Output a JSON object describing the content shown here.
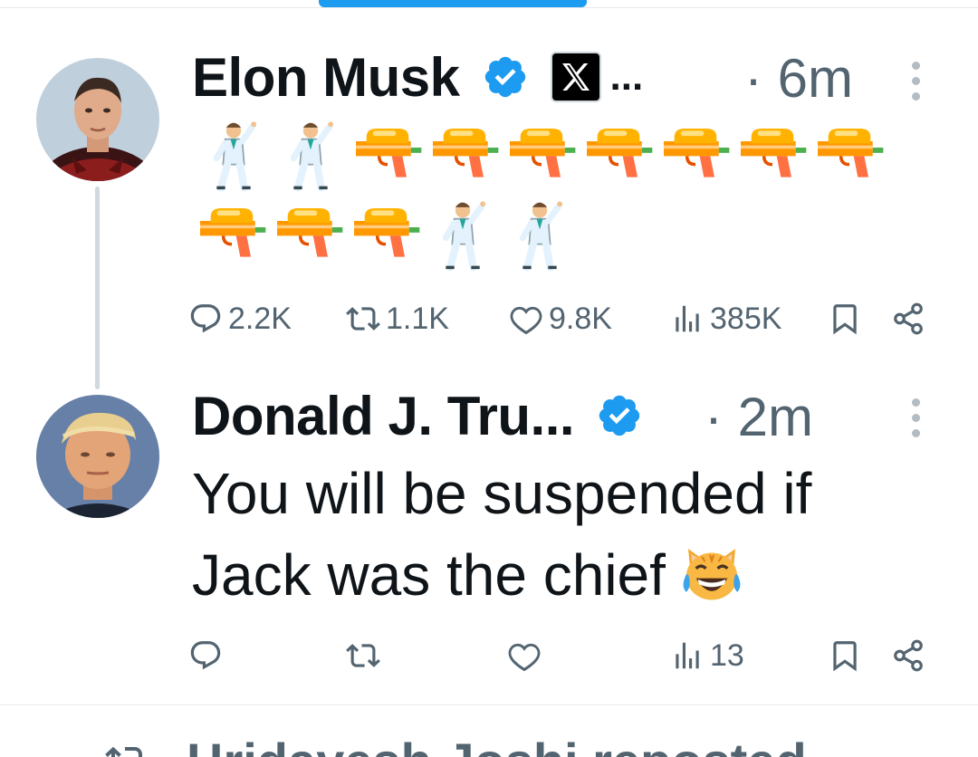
{
  "tweets": [
    {
      "author": {
        "display_name": "Elon Musk",
        "verified_color": "#1d9bf0",
        "affiliation_badge": "x-logo-icon",
        "truncation": "..."
      },
      "time": "· 6m",
      "content": {
        "emoji_line_1": [
          "man-dancing-icon",
          "man-dancing-icon",
          "water-pistol-icon",
          "water-pistol-icon",
          "water-pistol-icon",
          "water-pistol-icon",
          "water-pistol-icon",
          "water-pistol-icon",
          "water-pistol-icon"
        ],
        "emoji_line_2": [
          "water-pistol-icon",
          "water-pistol-icon",
          "water-pistol-icon",
          "man-dancing-icon",
          "man-dancing-icon"
        ]
      },
      "actions": {
        "replies": "2.2K",
        "reposts": "1.1K",
        "likes": "9.8K",
        "views": "385K"
      }
    },
    {
      "author": {
        "display_name": "Donald J. Tru...",
        "verified_color": "#1d9bf0"
      },
      "time": "· 2m",
      "content": {
        "text": "You will be suspended if Jack was the chief",
        "trailing_emoji": "cat-tears-of-joy-icon"
      },
      "actions": {
        "replies": "",
        "reposts": "",
        "likes": "",
        "views": "13"
      }
    }
  ],
  "next_item": {
    "repost_banner": "Hridayesh Joshi reposted"
  },
  "colors": {
    "accent": "#1d9bf0",
    "muted": "#536471",
    "text": "#0f1419",
    "divider": "#e6e9eb"
  }
}
